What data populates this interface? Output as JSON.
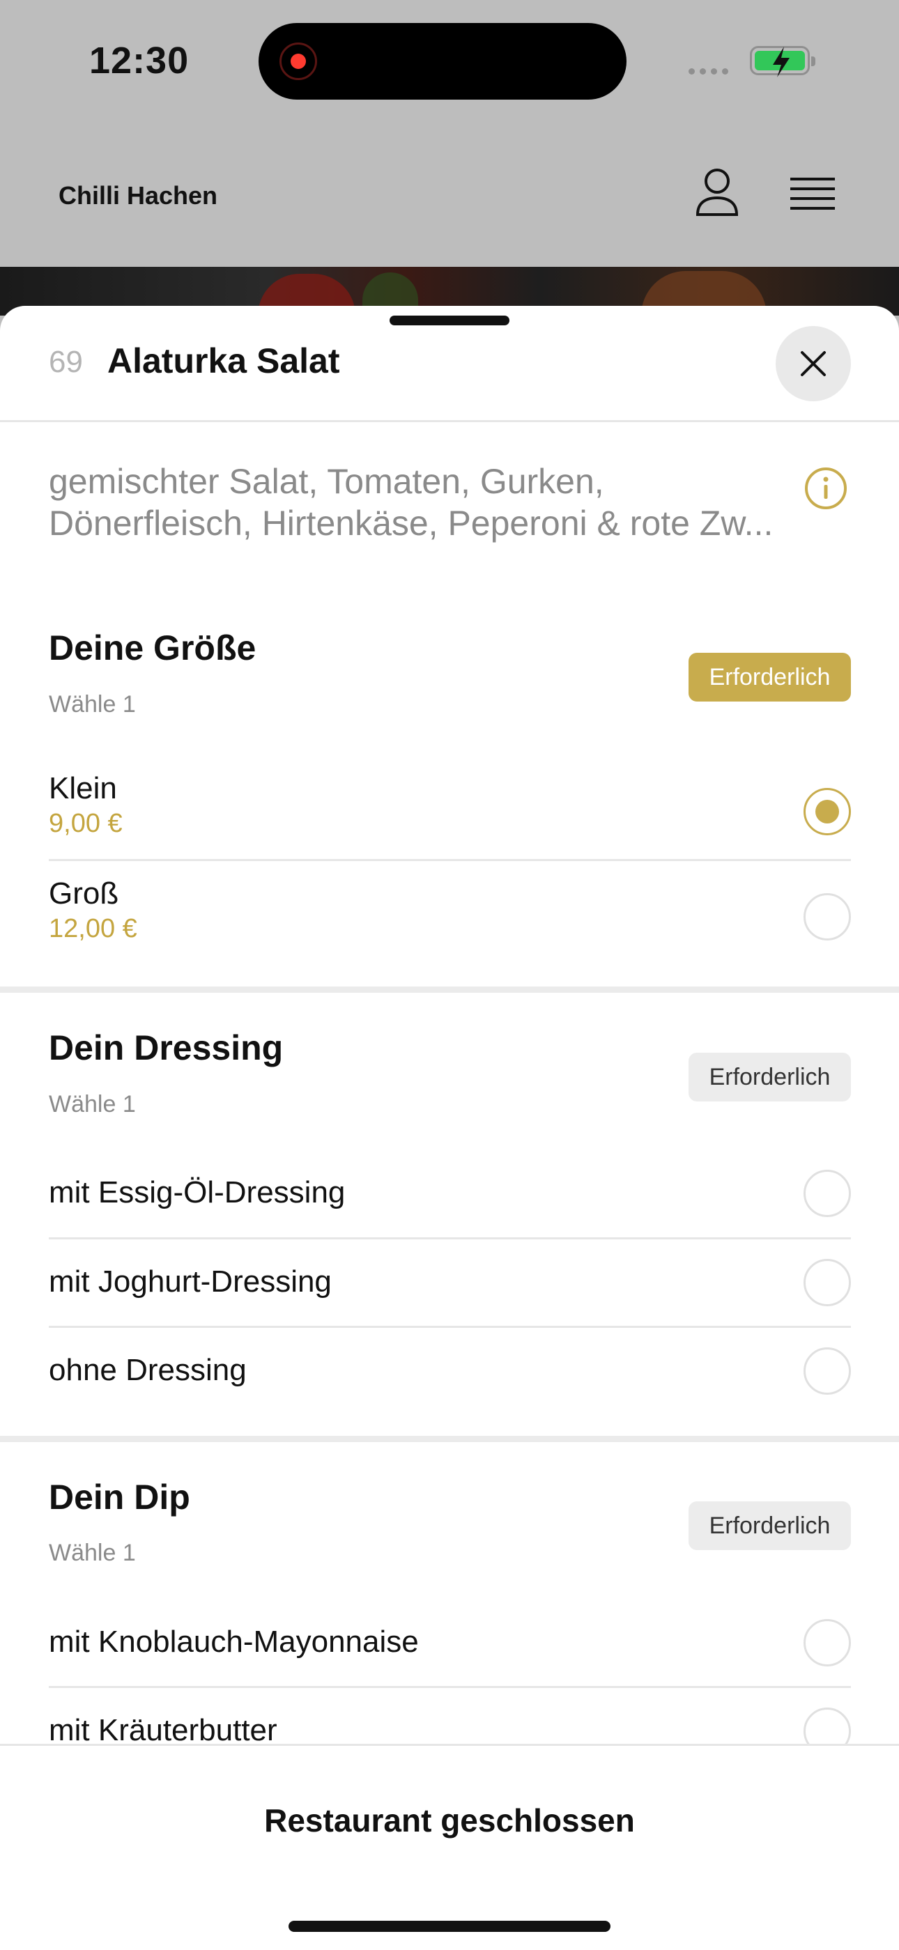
{
  "status": {
    "time": "12:30"
  },
  "header": {
    "brand": "Chilli Hachen"
  },
  "item": {
    "number": "69",
    "title": "Alaturka Salat",
    "description_line1": "gemischter Salat, Tomaten, Gurken,",
    "description_line2": "Dönerfleisch, Hirtenkäse, Peperoni & rote Zw..."
  },
  "sections": [
    {
      "title": "Deine Größe",
      "sub": "Wähle 1",
      "badge": "Erforderlich",
      "options": [
        {
          "label": "Klein",
          "price": "9,00 €",
          "selected": true
        },
        {
          "label": "Groß",
          "price": "12,00 €",
          "selected": false
        }
      ]
    },
    {
      "title": "Dein Dressing",
      "sub": "Wähle 1",
      "badge": "Erforderlich",
      "options": [
        {
          "label": "mit Essig-Öl-Dressing"
        },
        {
          "label": "mit Joghurt-Dressing"
        },
        {
          "label": "ohne Dressing"
        }
      ]
    },
    {
      "title": "Dein Dip",
      "sub": "Wähle 1",
      "badge": "Erforderlich",
      "options": [
        {
          "label": "mit Knoblauch-Mayonnaise"
        },
        {
          "label": "mit Kräuterbutter"
        }
      ]
    }
  ],
  "footer": {
    "label": "Restaurant geschlossen"
  },
  "colors": {
    "accent": "#c8ac4d",
    "price": "#c4a53f",
    "battery": "#32c759"
  }
}
